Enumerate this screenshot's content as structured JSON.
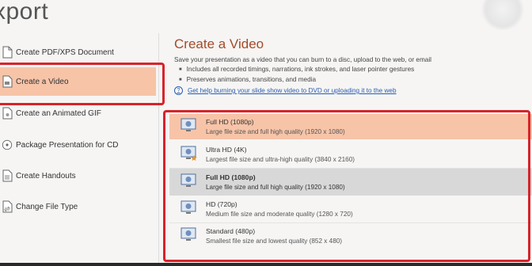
{
  "window": {
    "title": "xport"
  },
  "nav": {
    "items": [
      {
        "label": "Create PDF/XPS Document",
        "icon": "pdf-document-icon"
      },
      {
        "label": "Create a Video",
        "icon": "video-icon",
        "active": true
      },
      {
        "label": "Create an Animated GIF",
        "icon": "gif-icon"
      },
      {
        "label": "Package Presentation for CD",
        "icon": "cd-package-icon"
      },
      {
        "label": "Create Handouts",
        "icon": "handouts-icon"
      },
      {
        "label": "Change File Type",
        "icon": "file-type-icon"
      }
    ]
  },
  "main": {
    "title": "Create a Video",
    "description": "Save your presentation as a video that you can burn to a disc, upload to the web, or email",
    "bullets": [
      "Includes all recorded timings, narrations, ink strokes, and laser pointer gestures",
      "Preserves animations, transitions, and media"
    ],
    "help_link": "Get help burning your slide show video to DVD or uploading it to the web"
  },
  "quality": {
    "current": {
      "title": "Full HD (1080p)",
      "subtitle": "Large file size and full high quality (1920 x 1080)"
    },
    "options": [
      {
        "title": "Ultra HD (4K)",
        "subtitle": "Largest file size and ultra-high quality (3840 x 2160)",
        "starred": true
      },
      {
        "title": "Full HD (1080p)",
        "subtitle": "Large file size and full high quality (1920 x 1080)",
        "selected": true
      },
      {
        "title": "HD (720p)",
        "subtitle": "Medium file size and moderate quality (1280 x 720)"
      },
      {
        "title": "Standard (480p)",
        "subtitle": "Smallest file size and lowest quality (852 x 480)"
      }
    ]
  },
  "colors": {
    "accent": "#a44b27",
    "highlight": "#f7c4a8",
    "annotation_red": "#d8232a",
    "link": "#2a5db0"
  }
}
